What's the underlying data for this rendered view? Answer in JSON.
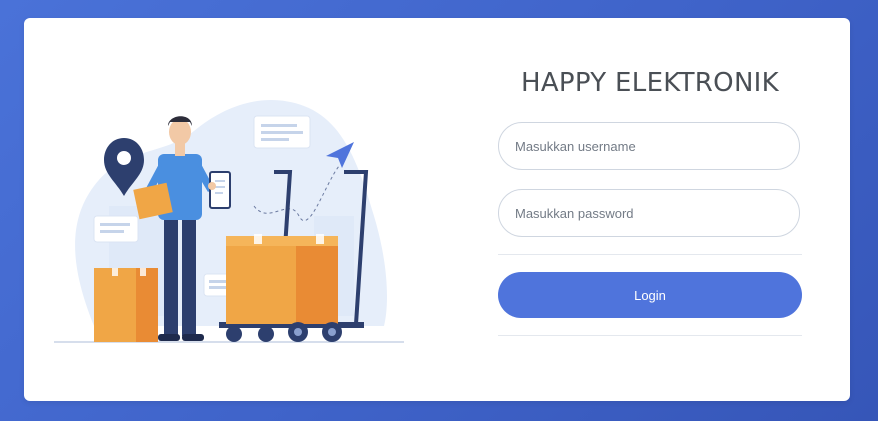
{
  "brand": {
    "title": "HAPPY ELEKTRONIK"
  },
  "form": {
    "username_placeholder": "Masukkan username",
    "password_placeholder": "Masukkan password",
    "login_label": "Login"
  },
  "colors": {
    "background": "#4a72d8",
    "card": "#ffffff",
    "accent": "#4f74dc",
    "title_text": "#4a4f55",
    "box_orange": "#f0a646"
  },
  "illustration": {
    "subject": "delivery-person-with-boxes-and-cart"
  }
}
